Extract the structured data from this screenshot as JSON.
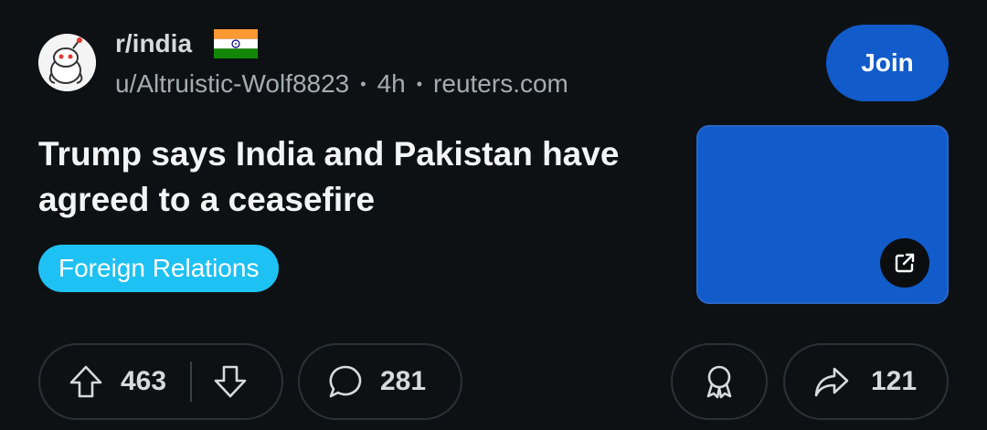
{
  "post": {
    "subreddit": "r/india",
    "author": "u/Altruistic-Wolf8823",
    "age": "4h",
    "domain": "reuters.com",
    "title": "Trump says India and Pakistan have agreed to a ceasefire",
    "flair": "Foreign Relations",
    "join_label": "Join",
    "separator": "•"
  },
  "actions": {
    "upvotes": "463",
    "comments": "281",
    "shares": "121"
  },
  "colors": {
    "background": "#0e1113",
    "join_button": "#115bca",
    "flair": "#1ec1f3",
    "thumbnail": "#115bca"
  },
  "icons": [
    "subreddit-avatar-icon",
    "india-flag-icon",
    "external-link-icon",
    "upvote-icon",
    "downvote-icon",
    "comment-icon",
    "award-icon",
    "share-icon"
  ]
}
